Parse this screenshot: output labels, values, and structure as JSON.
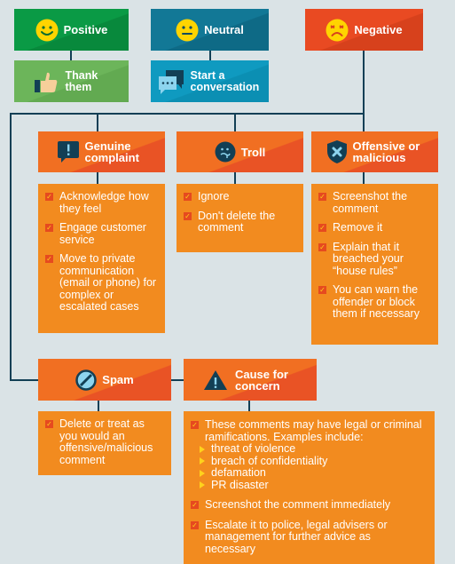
{
  "colors": {
    "background": "#dae3e6",
    "connector": "#123f55",
    "positive": "#0a9a45",
    "positive_action": "#6cb55a",
    "neutral": "#127896",
    "neutral_action": "#0f9ac0",
    "negative": "#e94a22",
    "category_header": "#f16f22",
    "content_box": "#f28b1f",
    "check_mark": "#ffd21c"
  },
  "sentiments": [
    {
      "label": "Positive",
      "icon": "smiley-happy-icon",
      "action": {
        "label": "Thank them",
        "icon": "thumbs-up-icon"
      }
    },
    {
      "label": "Neutral",
      "icon": "smiley-neutral-icon",
      "action": {
        "label": "Start a conversation",
        "icon": "chat-bubbles-icon"
      }
    },
    {
      "label": "Negative",
      "icon": "smiley-angry-icon"
    }
  ],
  "categories": [
    {
      "label": "Genuine complaint",
      "icon": "speech-exclamation-icon",
      "check_icon": "checkbox-icon",
      "items": [
        "Acknowledge how they feel",
        "Engage customer service",
        "Move to private communication (email or phone) for complex or escalated cases"
      ]
    },
    {
      "label": "Troll",
      "icon": "troll-face-icon",
      "items": [
        "Ignore",
        "Don't delete the comment"
      ]
    },
    {
      "label": "Offensive or malicious",
      "icon": "shield-x-icon",
      "items": [
        "Screenshot the comment",
        "Remove it",
        "Explain that it breached your “house rules”",
        "You can warn the offender or block them if necessary"
      ]
    },
    {
      "label": "Spam",
      "icon": "no-entry-icon",
      "items": [
        "Delete or treat as you would an offensive/malicious comment"
      ]
    },
    {
      "label": "Cause for concern",
      "icon": "warning-triangle-icon",
      "items": [
        "These comments may have legal or criminal ramifications. Examples include:",
        "Screenshot the comment immediately",
        "Escalate it to police, legal advisers or management for further advice as necessary"
      ],
      "examples": [
        "threat of violence",
        "breach of confidentiality",
        "defamation",
        "PR disaster"
      ]
    }
  ]
}
